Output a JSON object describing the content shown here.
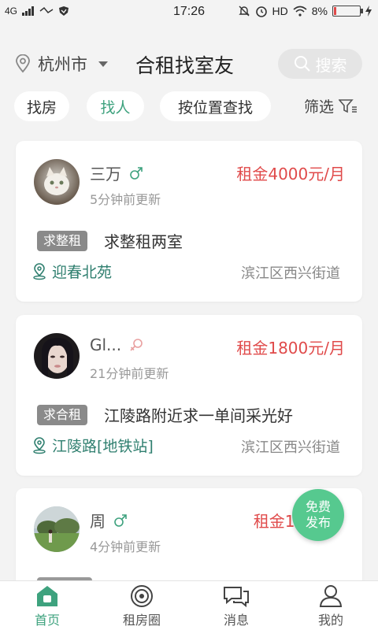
{
  "statusbar": {
    "network": "4G",
    "time": "17:26",
    "hd": "HD",
    "battery_percent": "8%",
    "battery_level": 0.08,
    "battery_color": "#e04a4a"
  },
  "header": {
    "city": "杭州市",
    "title": "合租找室友",
    "search_label": "搜索"
  },
  "filters": {
    "chips": [
      {
        "label": "找房",
        "active": false
      },
      {
        "label": "找人",
        "active": true
      },
      {
        "label": "按位置查找",
        "active": false
      }
    ],
    "filter_label": "筛选"
  },
  "listings": [
    {
      "name": "三万",
      "gender_icon": "male-icon",
      "updated": "5分钟前更新",
      "price": "租金4000元/月",
      "tag": "求整租",
      "description": "求整租两室",
      "location": "迎春北苑",
      "district": "滨江区西兴街道"
    },
    {
      "name": "Gl...",
      "gender_icon": "female-icon",
      "updated": "21分钟前更新",
      "price": "租金1800元/月",
      "tag": "求合租",
      "description": "江陵路附近求一单间采光好",
      "location": "江陵路[地铁站]",
      "district": "滨江区西兴街道"
    },
    {
      "name": "周",
      "gender_icon": "male-icon",
      "updated": "4分钟前更新",
      "price": "租金160"
    }
  ],
  "fab": {
    "line1": "免费",
    "line2": "发布"
  },
  "bottom_nav": [
    {
      "label": "首页",
      "icon": "home-icon",
      "active": true
    },
    {
      "label": "租房圈",
      "icon": "circle-icon",
      "active": false
    },
    {
      "label": "消息",
      "icon": "message-icon",
      "active": false
    },
    {
      "label": "我的",
      "icon": "profile-icon",
      "active": false
    }
  ],
  "colors": {
    "accent": "#3ea27e",
    "price": "#e04a4a",
    "fab": "#56c98f",
    "location": "#2f7f6f"
  }
}
